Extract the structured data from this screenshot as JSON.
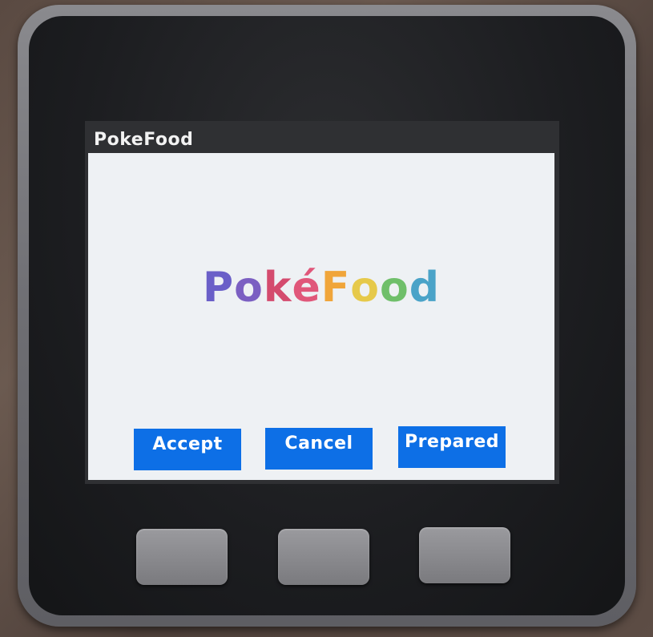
{
  "window": {
    "title": "PokeFood"
  },
  "logo": {
    "letters": [
      "P",
      "o",
      "k",
      "é",
      "F",
      "o",
      "o",
      "d"
    ],
    "colors": [
      "#6a5fc8",
      "#7b5fc2",
      "#d44b6e",
      "#e0577a",
      "#f0a53a",
      "#e6c94a",
      "#6fbf6a",
      "#4aa3c8"
    ]
  },
  "buttons": {
    "accept": "Accept",
    "cancel": "Cancel",
    "prepared": "Prepared"
  },
  "colors": {
    "button_bg": "#0d6fe6",
    "title_bar_bg": "#2f3033",
    "content_bg": "#eef1f4"
  }
}
